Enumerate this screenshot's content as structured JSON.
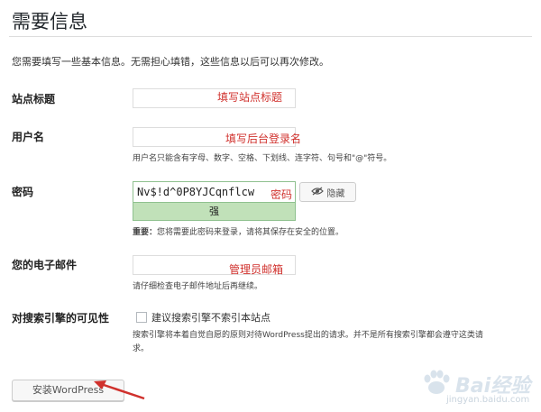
{
  "page": {
    "title": "需要信息",
    "intro": "您需要填写一些基本信息。无需担心填错，这些信息以后可以再次修改。"
  },
  "site_title": {
    "label": "站点标题",
    "annotation": "填写站点标题"
  },
  "username": {
    "label": "用户名",
    "annotation": "填写后台登录名",
    "hint": "用户名只能含有字母、数字、空格、下划线、连字符、句号和\"@\"符号。"
  },
  "password": {
    "label": "密码",
    "value": "Nv$!d^0P8YJCqnflcw",
    "annotation": "密码",
    "strength": "强",
    "hide_button": "隐藏",
    "hint_strong": "重要：",
    "hint": "您将需要此密码来登录，请将其保存在安全的位置。"
  },
  "email": {
    "label": "您的电子邮件",
    "annotation": "管理员邮箱",
    "hint": "请仔细检查电子邮件地址后再继续。"
  },
  "visibility": {
    "label": "对搜索引擎的可见性",
    "checkbox_label": "建议搜索引擎不索引本站点",
    "hint_line1": "搜索引擎将本着自觉自愿的原则对待WordPress提出的请求。并不是所有搜索引擎都会遵守这类请",
    "hint_line2": "求。",
    "checked": false
  },
  "install": {
    "button_label": "安装WordPress"
  },
  "watermark": {
    "text": "Bai经验",
    "sub": "jingyan.baidu.com"
  },
  "colors": {
    "annotation": "#d0312d",
    "strength_bg": "#c1e1b9",
    "arrow": "#d0312d"
  }
}
